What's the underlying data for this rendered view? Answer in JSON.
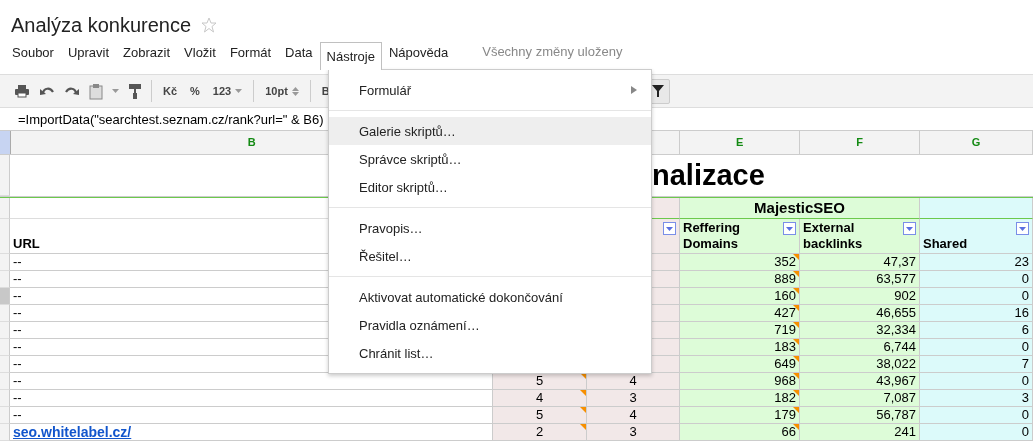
{
  "document": {
    "title": "Analýza konkurence",
    "starred": false
  },
  "menu_bar": {
    "items": [
      {
        "label": "Soubor",
        "selected": false
      },
      {
        "label": "Upravit",
        "selected": false
      },
      {
        "label": "Zobrazit",
        "selected": false
      },
      {
        "label": "Vložit",
        "selected": false
      },
      {
        "label": "Formát",
        "selected": false
      },
      {
        "label": "Data",
        "selected": false
      },
      {
        "label": "Nástroje",
        "selected": true
      },
      {
        "label": "Nápověda",
        "selected": false
      }
    ],
    "save_status": "Všechny změny uloženy"
  },
  "toolbar": {
    "labels": [
      {
        "text": "Kč",
        "kind": "plain"
      },
      {
        "text": "%",
        "kind": "plain"
      },
      {
        "text": "123",
        "kind": "dropdown"
      },
      {
        "text": "10pt",
        "kind": "spinner"
      },
      {
        "text": "B",
        "kind": "plain"
      }
    ]
  },
  "formula_bar": {
    "formula": "=ImportData(\"searchtest.seznam.cz/rank?url=\" & B6)"
  },
  "sheet": {
    "columns": [
      {
        "letter": "B",
        "color": "#ffffff",
        "header": "URL"
      },
      {
        "color": "#f2e8e8"
      },
      {
        "color": "#f2e8e8",
        "filter": true
      },
      {
        "letter": "E",
        "color": "#ddfcd8",
        "header": "Reffering Domains",
        "filter": true
      },
      {
        "letter": "F",
        "color": "#ddfcd8",
        "header": "External backlinks",
        "filter": true
      },
      {
        "letter": "G",
        "color": "#dcfafa",
        "header": "Shared",
        "filter": true
      }
    ],
    "title_fragment": "nalizace",
    "group_label": "MajesticSEO",
    "rows": [
      {
        "selected": false,
        "cells": [
          {
            "text": "--"
          },
          {},
          {},
          {
            "text": "352",
            "note": true
          },
          {
            "text": "47,37"
          },
          {
            "text": "23"
          }
        ]
      },
      {
        "selected": false,
        "cells": [
          {
            "text": "--"
          },
          {},
          {},
          {
            "text": "889",
            "note": true
          },
          {
            "text": "63,577"
          },
          {
            "text": "0"
          }
        ]
      },
      {
        "selected": true,
        "cells": [
          {
            "text": "--"
          },
          {},
          {},
          {
            "text": "160",
            "note": true
          },
          {
            "text": "902"
          },
          {
            "text": "0"
          }
        ]
      },
      {
        "selected": false,
        "cells": [
          {
            "text": "--"
          },
          {},
          {},
          {
            "text": "427",
            "note": true
          },
          {
            "text": "46,655"
          },
          {
            "text": "16"
          }
        ]
      },
      {
        "selected": false,
        "cells": [
          {
            "text": "--"
          },
          {},
          {},
          {
            "text": "719",
            "note": true
          },
          {
            "text": "32,334"
          },
          {
            "text": "6"
          }
        ]
      },
      {
        "selected": false,
        "cells": [
          {
            "text": "--"
          },
          {},
          {},
          {
            "text": "183",
            "note": true
          },
          {
            "text": "6,744"
          },
          {
            "text": "0"
          }
        ]
      },
      {
        "selected": false,
        "cells": [
          {
            "text": "--"
          },
          {},
          {},
          {
            "text": "649",
            "note": true
          },
          {
            "text": "38,022"
          },
          {
            "text": "7"
          }
        ]
      },
      {
        "selected": false,
        "cells": [
          {
            "text": "--"
          },
          {
            "text": "5",
            "note": true
          },
          {
            "text": "4"
          },
          {
            "text": "968",
            "note": true
          },
          {
            "text": "43,967"
          },
          {
            "text": "0"
          }
        ]
      },
      {
        "selected": false,
        "cells": [
          {
            "text": "--"
          },
          {
            "text": "4",
            "note": true
          },
          {
            "text": "3"
          },
          {
            "text": "182",
            "note": true
          },
          {
            "text": "7,087"
          },
          {
            "text": "3"
          }
        ]
      },
      {
        "selected": false,
        "cells": [
          {
            "text": "--"
          },
          {
            "text": "5",
            "note": true
          },
          {
            "text": "4"
          },
          {
            "text": "179",
            "note": true
          },
          {
            "text": "56,787"
          },
          {
            "text": "0"
          }
        ]
      },
      {
        "selected": false,
        "cells": [
          {
            "text": "seo.whitelabel.cz/",
            "kind": "link"
          },
          {
            "text": "2",
            "note": true
          },
          {
            "text": "3"
          },
          {
            "text": "66",
            "note": true
          },
          {
            "text": "241"
          },
          {
            "text": "0"
          }
        ]
      }
    ]
  },
  "dropdown_menu": {
    "items": [
      {
        "kind": "item",
        "label": "Formulář",
        "submenu": true,
        "selected": false
      },
      {
        "kind": "separator"
      },
      {
        "kind": "item",
        "label": "Galerie skriptů…",
        "selected": true
      },
      {
        "kind": "item",
        "label": "Správce skriptů…",
        "selected": false
      },
      {
        "kind": "item",
        "label": "Editor skriptů…",
        "selected": false
      },
      {
        "kind": "separator"
      },
      {
        "kind": "item",
        "label": "Pravopis…",
        "selected": false
      },
      {
        "kind": "item",
        "label": "Řešitel…",
        "selected": false
      },
      {
        "kind": "separator"
      },
      {
        "kind": "item",
        "label": "Aktivovat automatické dokončování",
        "selected": false
      },
      {
        "kind": "item",
        "label": "Pravidla oznámení…",
        "selected": false
      },
      {
        "kind": "item",
        "label": "Chránit list…",
        "selected": false
      }
    ]
  }
}
